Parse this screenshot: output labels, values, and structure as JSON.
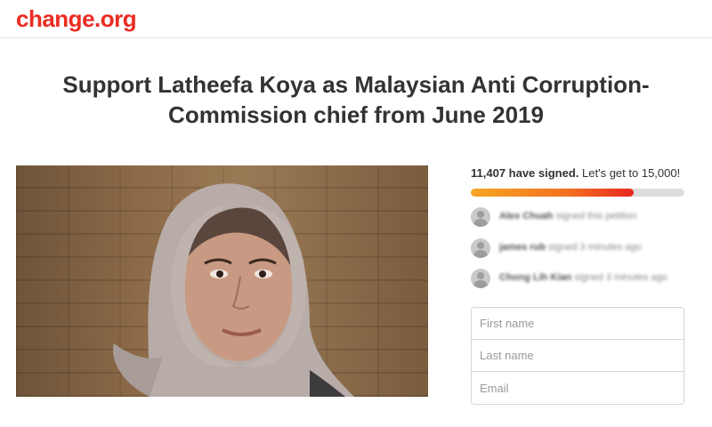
{
  "header": {
    "logo": "change.org"
  },
  "petition": {
    "title": "Support Latheefa Koya as Malaysian Anti Corruption-Commission chief from June 2019",
    "photo_icon": "person-photo"
  },
  "signatures": {
    "count_label": "11,407 have signed.",
    "goal_label": "Let's get to 15,000!",
    "progress": 0.7605,
    "recent": [
      {
        "name": "Alex Chuah",
        "action": "signed this petition"
      },
      {
        "name": "james rub",
        "action": "signed 3 minutes ago"
      },
      {
        "name": "Chong Lih Kian",
        "action": "signed 3 minutes ago"
      }
    ]
  },
  "form": {
    "first_name_placeholder": "First name",
    "last_name_placeholder": "Last name",
    "email_placeholder": "Email"
  },
  "colors": {
    "brand": "#ec2c22",
    "progress_start": "#f6a623",
    "progress_end": "#e8271e"
  }
}
